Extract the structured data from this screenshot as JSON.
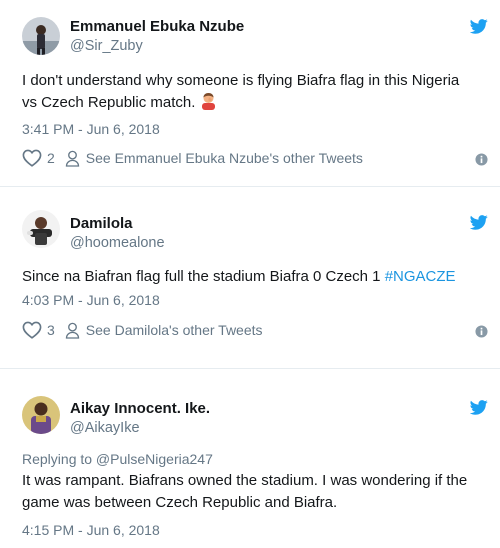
{
  "colors": {
    "brand": "#1da1f2",
    "hashtag": "#1b95e0",
    "secondary": "#657786",
    "text": "#14171a"
  },
  "tweets": [
    {
      "name": "Emmanuel Ebuka Nzube",
      "handle": "@Sir_Zuby",
      "text": "I don't understand why someone is flying Biafra flag in this Nigeria vs Czech Republic match.",
      "emoji": "man-facepalming-emoji",
      "timestamp": "3:41 PM - Jun 6, 2018",
      "likes": "2",
      "other_tweets": "See Emmanuel Ebuka Nzube's other Tweets"
    },
    {
      "name": "Damilola",
      "handle": "@hoomealone",
      "text": "Since na Biafran flag full the stadium Biafra 0 Czech 1 ",
      "hashtag": "#NGACZE",
      "timestamp": "4:03 PM - Jun 6, 2018",
      "likes": "3",
      "other_tweets": "See Damilola's other Tweets"
    },
    {
      "name": "Aikay Innocent. Ike.",
      "handle": "@AikayIke",
      "replying_to": "Replying to @PulseNigeria247",
      "text": "It was rampant. Biafrans owned the stadium. I was wondering if the game was between Czech Republic and Biafra.",
      "timestamp": "4:15 PM - Jun 6, 2018"
    }
  ]
}
